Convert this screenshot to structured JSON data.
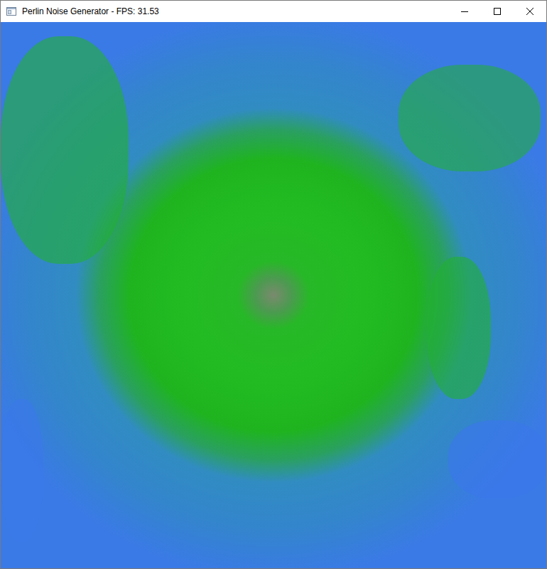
{
  "window": {
    "title": "Perlin Noise Generator - FPS: 31.53"
  }
}
